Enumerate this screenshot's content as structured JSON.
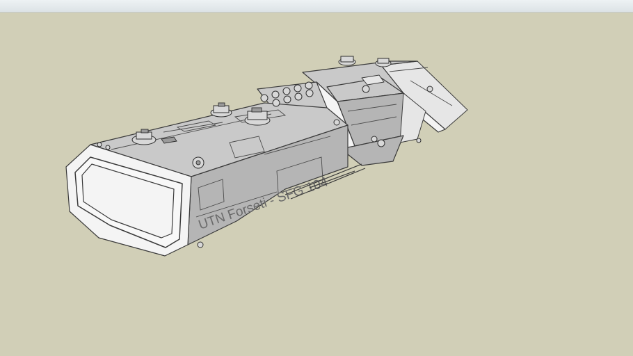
{
  "window": {
    "background_color": "#d1cfb7",
    "toolbar_color": "#e8edf0"
  },
  "model": {
    "hull_label": "UTN Forseti - SFG 104"
  }
}
